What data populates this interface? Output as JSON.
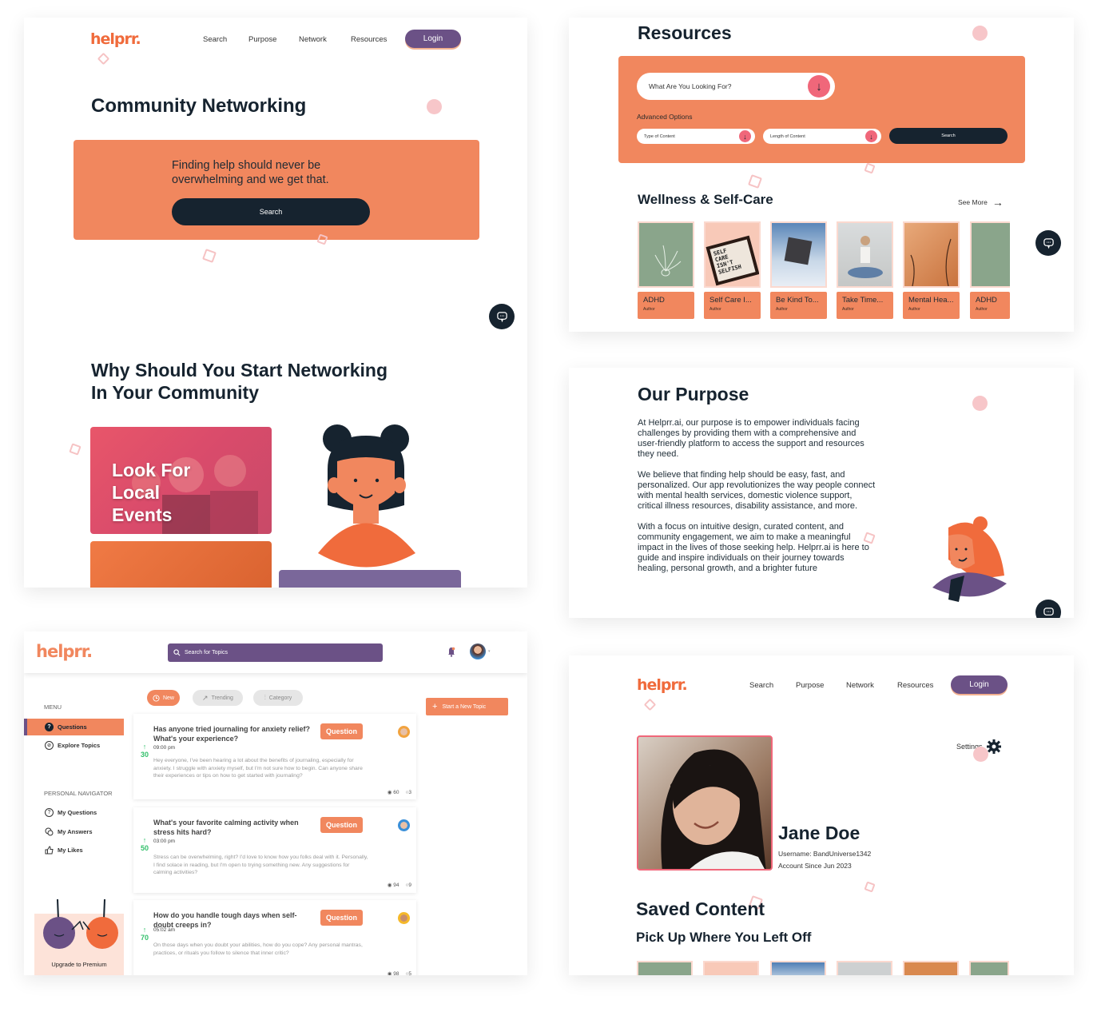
{
  "brand": {
    "logo": "helprr.",
    "colors": {
      "orange": "#f1875e",
      "deep_orange": "#f06b3c",
      "purple": "#6b5186",
      "navy": "#16232f",
      "pink": "#f0677a",
      "light_pink": "#f7c6c9",
      "green": "#33c06b"
    }
  },
  "nav": {
    "links": [
      "Search",
      "Purpose",
      "Network",
      "Resources"
    ],
    "login": "Login"
  },
  "community": {
    "title": "Community Networking",
    "hero_text": "Finding help should never be overwhelming and we get that.",
    "search_button": "Search",
    "why_title_line1": "Why Should You Start Networking",
    "why_title_line2": "In Your Community",
    "event_card_title_lines": [
      "Look For",
      "Local",
      "Events"
    ],
    "chat_icon": "chat-bubble-icon"
  },
  "resources": {
    "title": "Resources",
    "search_placeholder": "What Are You Looking For?",
    "advanced_label": "Advanced Options",
    "type_placeholder": "Type of Content",
    "length_placeholder": "Length of Content",
    "search_button": "Search",
    "section_title": "Wellness & Self-Care",
    "see_more": "See More",
    "cards": [
      {
        "title": "ADHD",
        "author": "Author"
      },
      {
        "title": "Self Care I...",
        "author": "Author"
      },
      {
        "title": "Be Kind To...",
        "author": "Author"
      },
      {
        "title": "Take Time...",
        "author": "Author"
      },
      {
        "title": "Mental Hea...",
        "author": "Author"
      },
      {
        "title": "ADHD",
        "author": "Author"
      }
    ],
    "self_care_sign_lines": [
      "SELF",
      "CARE",
      "ISN'T",
      "SELFISH"
    ]
  },
  "purpose": {
    "title": "Our Purpose",
    "paragraphs": [
      "At Helprr.ai, our purpose is to empower individuals facing challenges by providing them with a comprehensive and user-friendly platform to access the support and resources they need.",
      "We believe that finding help should be easy, fast, and personalized. Our app revolutionizes the way people connect with mental health services, domestic violence support, critical illness resources, disability assistance, and more.",
      "With a focus on intuitive design, curated content, and community engagement, we aim to make a meaningful impact in the lives of those seeking help. Helprr.ai is here to guide and inspire individuals on their journey towards healing, personal growth, and a brighter future"
    ]
  },
  "forum": {
    "search_placeholder": "Search for Topics",
    "menu_label": "MENU",
    "menu_items": [
      "Questions",
      "Explore Topics"
    ],
    "personal_label": "PERSONAL NAVIGATOR",
    "personal_items": [
      "My Questions",
      "My Answers",
      "My Likes"
    ],
    "upgrade": "Upgrade to Premium",
    "filters": [
      "New",
      "Trending",
      "Category"
    ],
    "new_topic": "Start a New Topic",
    "questions": [
      {
        "title": "Has anyone tried journaling for anxiety relief? What's your experience?",
        "time": "09:00 pm",
        "votes": "30",
        "body": "Hey everyone, I've been hearing a lot about the benefits of journaling, especially for anxiety. I struggle with anxiety myself, but I'm not sure how to begin. Can anyone share their experiences or tips on how to get started with journaling?",
        "badge": "Question",
        "views": "60",
        "comments": "3"
      },
      {
        "title": "What's your favorite calming activity when stress hits hard?",
        "time": "03:00 pm",
        "votes": "50",
        "body": "Stress can be overwhelming, right? I'd love to know how you folks deal with it. Personally, I find solace in reading, but I'm open to trying something new. Any suggestions for calming activities?",
        "badge": "Question",
        "views": "94",
        "comments": "9"
      },
      {
        "title": "How do you handle tough days when self-doubt creeps in?",
        "time": "05:02 am",
        "votes": "70",
        "body": "On those days when you doubt your abilities, how do you cope? Any personal mantras, practices, or rituals you follow to silence that inner critic?",
        "badge": "Question",
        "views": "98",
        "comments": "5"
      }
    ]
  },
  "profile": {
    "settings": "Settings",
    "name": "Jane Doe",
    "username": "Username: BandUniverse1342",
    "since": "Account Since Jun 2023",
    "saved_title": "Saved Content",
    "saved_subtitle": "Pick Up Where You Left Off"
  }
}
